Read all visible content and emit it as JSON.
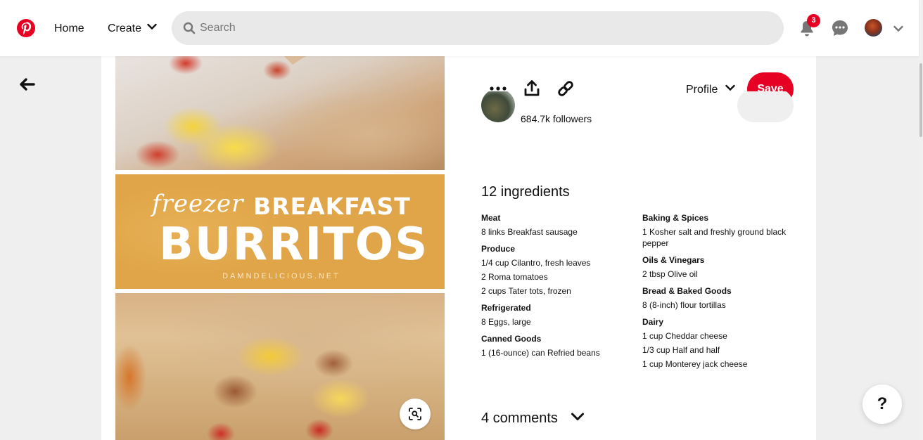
{
  "header": {
    "nav_home": "Home",
    "nav_create": "Create",
    "search_placeholder": "Search",
    "notification_count": "3",
    "brand_color": "#e60023"
  },
  "pin": {
    "image": {
      "overlay_word_script": "freezer",
      "overlay_word_1": "BREAKFAST",
      "overlay_word_2": "BURRITOS",
      "overlay_site": "DAMNDELICIOUS.NET"
    },
    "actions": {
      "more_icon": "more-icon",
      "share_icon": "share-icon",
      "link_icon": "link-icon",
      "board_select": "Profile",
      "save_label": "Save"
    },
    "creator": {
      "followers": "684.7k followers"
    },
    "ingredients": {
      "title": "12 ingredients",
      "left": [
        {
          "category": "Meat",
          "items": [
            "8 links Breakfast sausage"
          ]
        },
        {
          "category": "Produce",
          "items": [
            "1/4 cup Cilantro, fresh leaves",
            "2 Roma tomatoes",
            "2 cups Tater tots, frozen"
          ]
        },
        {
          "category": "Refrigerated",
          "items": [
            "8 Eggs, large"
          ]
        },
        {
          "category": "Canned Goods",
          "items": [
            "1 (16-ounce) can Refried beans"
          ]
        }
      ],
      "right": [
        {
          "category": "Baking & Spices",
          "items": [
            "1 Kosher salt and freshly ground black pepper"
          ]
        },
        {
          "category": "Oils & Vinegars",
          "items": [
            "2 tbsp Olive oil"
          ]
        },
        {
          "category": "Bread & Baked Goods",
          "items": [
            "8 (8-inch) flour tortillas"
          ]
        },
        {
          "category": "Dairy",
          "items": [
            "1 cup Cheddar cheese",
            "1/3 cup Half and half",
            "1 cup Monterey jack cheese"
          ]
        }
      ]
    },
    "comments_label": "4 comments"
  },
  "help_label": "?"
}
